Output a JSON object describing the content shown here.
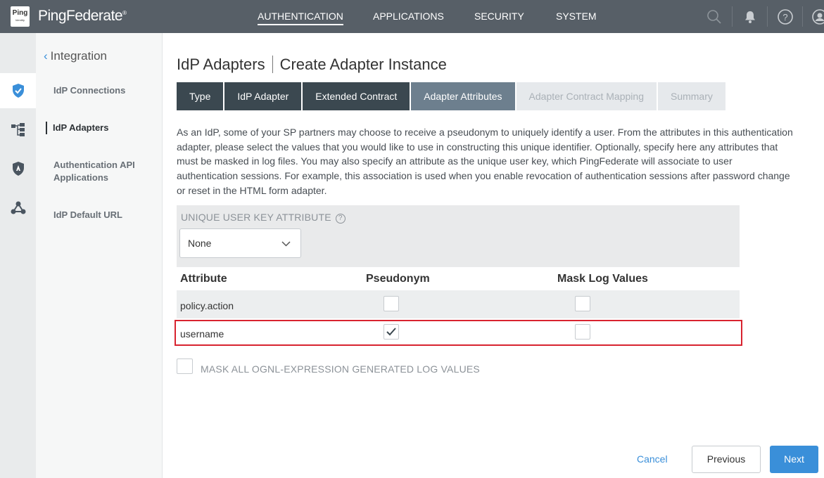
{
  "brand": {
    "logo_text": "Ping",
    "logo_sub": "Identity",
    "name": "PingFederate"
  },
  "topnav": {
    "items": [
      "AUTHENTICATION",
      "APPLICATIONS",
      "SECURITY",
      "SYSTEM"
    ]
  },
  "sidenav": {
    "back_label": "Integration",
    "items": [
      "IdP Connections",
      "IdP Adapters",
      "Authentication API Applications",
      "IdP Default URL"
    ]
  },
  "page": {
    "title_main": "IdP Adapters",
    "title_sub": "Create Adapter Instance"
  },
  "tabs": [
    "Type",
    "IdP Adapter",
    "Extended Contract",
    "Adapter Attributes",
    "Adapter Contract Mapping",
    "Summary"
  ],
  "description": "As an IdP, some of your SP partners may choose to receive a pseudonym to uniquely identify a user. From the attributes in this authentication adapter, please select the values that you would like to use in constructing this unique identifier. Optionally, specify here any attributes that must be masked in log files. You may also specify an attribute as the unique user key, which PingFederate will associate to user authentication sessions. For example, this association is used when you enable revocation of authentication sessions after password change or reset in the HTML form adapter.",
  "unique_key": {
    "label": "UNIQUE USER KEY ATTRIBUTE",
    "help": "?",
    "selected": "None"
  },
  "table": {
    "headers": [
      "Attribute",
      "Pseudonym",
      "Mask Log Values"
    ],
    "rows": [
      {
        "attribute": "policy.action",
        "pseudonym": false,
        "mask": false
      },
      {
        "attribute": "username",
        "pseudonym": true,
        "mask": false
      }
    ]
  },
  "mask_all": {
    "label": "MASK ALL OGNL-EXPRESSION GENERATED LOG VALUES",
    "checked": false
  },
  "buttons": {
    "cancel": "Cancel",
    "previous": "Previous",
    "next": "Next"
  },
  "colors": {
    "accent": "#3a8fd9",
    "highlight": "#d8232f",
    "topbar": "#575f67"
  }
}
